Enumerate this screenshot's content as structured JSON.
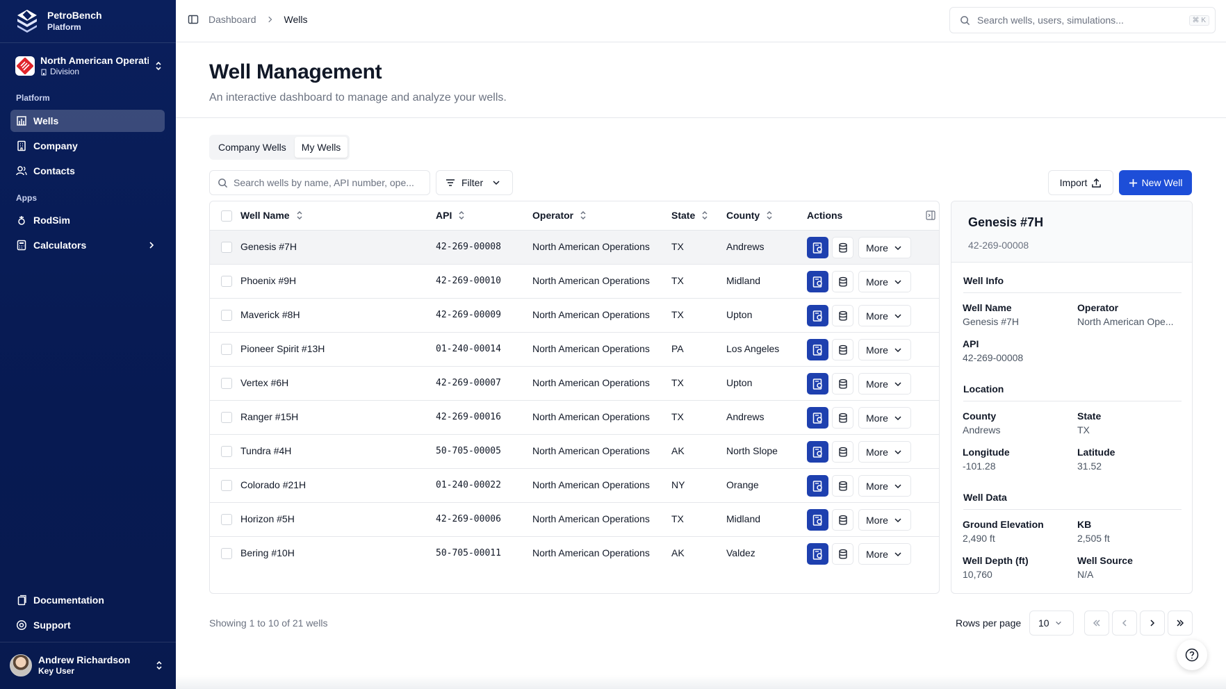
{
  "brand": {
    "name": "PetroBench",
    "sub": "Platform"
  },
  "org": {
    "name": "North American Operations",
    "type": "Division"
  },
  "sidebar": {
    "platform_label": "Platform",
    "platform_items": [
      {
        "label": "Wells",
        "icon": "building-icon",
        "active": true
      },
      {
        "label": "Company",
        "icon": "office-icon"
      },
      {
        "label": "Contacts",
        "icon": "users-icon"
      }
    ],
    "apps_label": "Apps",
    "app_items": [
      {
        "label": "RodSim",
        "icon": "rodsim-icon"
      },
      {
        "label": "Calculators",
        "icon": "calculator-icon"
      }
    ],
    "bottom_items": [
      {
        "label": "Documentation",
        "icon": "document-icon"
      },
      {
        "label": "Support",
        "icon": "lifebuoy-icon"
      }
    ]
  },
  "user": {
    "name": "Andrew Richardson",
    "role": "Key User"
  },
  "breadcrumb": {
    "parent": "Dashboard",
    "current": "Wells"
  },
  "search": {
    "placeholder": "Search wells, users, simulations...",
    "shortcut": "⌘ K"
  },
  "page": {
    "title": "Well Management",
    "subtitle": "An interactive dashboard to manage and analyze your wells."
  },
  "tabs": {
    "company": "Company Wells",
    "mine": "My Wells"
  },
  "toolbar": {
    "search_placeholder": "Search wells by name, API number, ope...",
    "filter": "Filter",
    "import": "Import",
    "new_well": "New Well"
  },
  "table": {
    "headers": {
      "name": "Well Name",
      "api": "API",
      "operator": "Operator",
      "state": "State",
      "county": "County",
      "actions": "Actions"
    },
    "more_label": "More",
    "rows": [
      {
        "name": "Genesis #7H",
        "api": "42-269-00008",
        "operator": "North American Operations",
        "state": "TX",
        "county": "Andrews"
      },
      {
        "name": "Phoenix #9H",
        "api": "42-269-00010",
        "operator": "North American Operations",
        "state": "TX",
        "county": "Midland"
      },
      {
        "name": "Maverick #8H",
        "api": "42-269-00009",
        "operator": "North American Operations",
        "state": "TX",
        "county": "Upton"
      },
      {
        "name": "Pioneer Spirit #13H",
        "api": "01-240-00014",
        "operator": "North American Operations",
        "state": "PA",
        "county": "Los Angeles"
      },
      {
        "name": "Vertex #6H",
        "api": "42-269-00007",
        "operator": "North American Operations",
        "state": "TX",
        "county": "Upton"
      },
      {
        "name": "Ranger #15H",
        "api": "42-269-00016",
        "operator": "North American Operations",
        "state": "TX",
        "county": "Andrews"
      },
      {
        "name": "Tundra #4H",
        "api": "50-705-00005",
        "operator": "North American Operations",
        "state": "AK",
        "county": "North Slope"
      },
      {
        "name": "Colorado #21H",
        "api": "01-240-00022",
        "operator": "North American Operations",
        "state": "NY",
        "county": "Orange"
      },
      {
        "name": "Horizon #5H",
        "api": "42-269-00006",
        "operator": "North American Operations",
        "state": "TX",
        "county": "Midland"
      },
      {
        "name": "Bering #10H",
        "api": "50-705-00011",
        "operator": "North American Operations",
        "state": "AK",
        "county": "Valdez"
      }
    ]
  },
  "detail": {
    "title": "Genesis #7H",
    "api": "42-269-00008",
    "well_info": {
      "heading": "Well Info",
      "well_name_label": "Well Name",
      "well_name": "Genesis #7H",
      "operator_label": "Operator",
      "operator": "North American Ope...",
      "api_label": "API",
      "api": "42-269-00008"
    },
    "location": {
      "heading": "Location",
      "county_label": "County",
      "county": "Andrews",
      "state_label": "State",
      "state": "TX",
      "longitude_label": "Longitude",
      "longitude": "-101.28",
      "latitude_label": "Latitude",
      "latitude": "31.52"
    },
    "well_data": {
      "heading": "Well Data",
      "elevation_label": "Ground Elevation",
      "elevation": "2,490 ft",
      "kb_label": "KB",
      "kb": "2,505 ft",
      "depth_label": "Well Depth (ft)",
      "depth": "10,760",
      "source_label": "Well Source",
      "source": "N/A"
    }
  },
  "pagination": {
    "showing": "Showing 1 to 10 of 21 wells",
    "rows_label": "Rows per page",
    "rows_value": "10"
  },
  "colors": {
    "sidebar": "#0a1f5c",
    "primary": "#1d4ed8",
    "action_blue": "#1e40af"
  }
}
